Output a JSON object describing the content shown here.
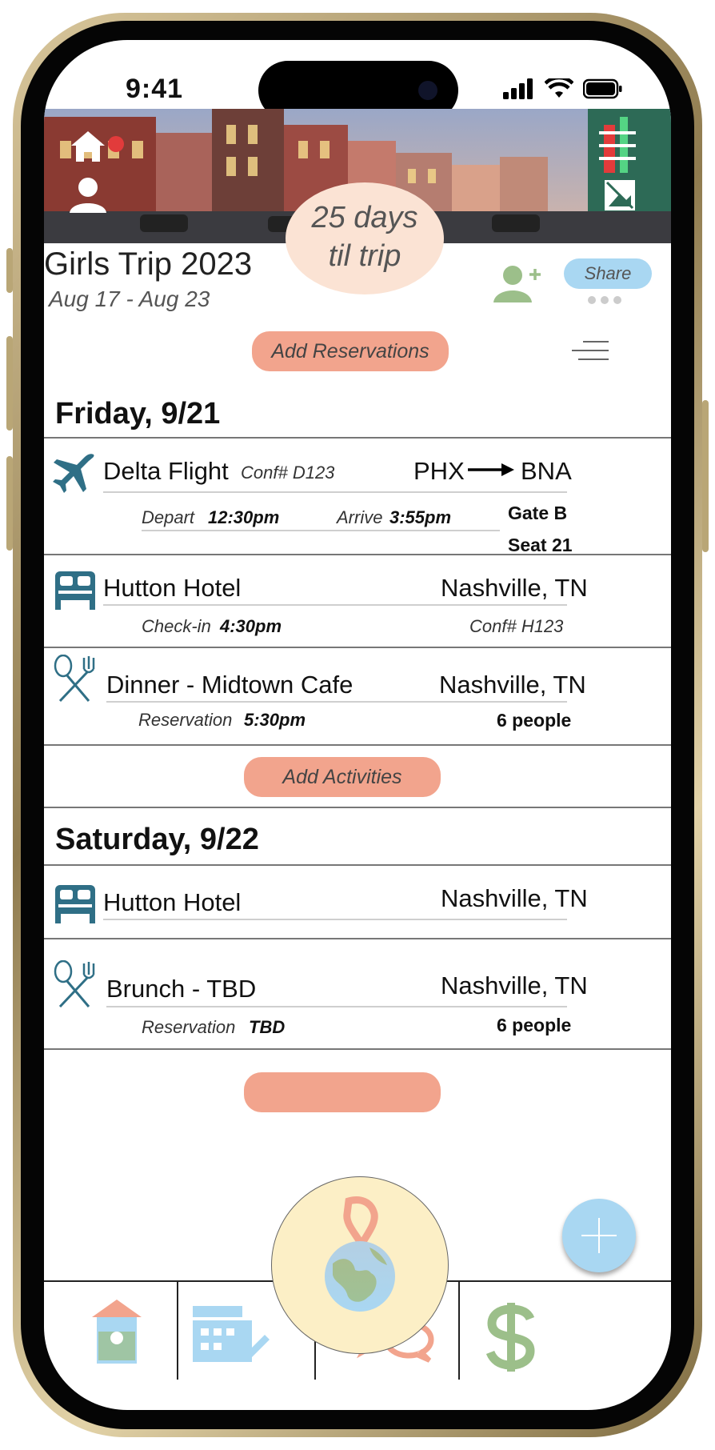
{
  "status_bar": {
    "time": "9:41"
  },
  "trip": {
    "title": "Girls Trip 2023",
    "dates": "Aug 17 - Aug 23",
    "countdown_line1": "25 days",
    "countdown_line2": "til trip",
    "share_label": "Share"
  },
  "actions": {
    "add_reservations": "Add Reservations",
    "add_activities": "Add Activities"
  },
  "days": [
    {
      "heading": "Friday, 9/21",
      "flight": {
        "name": "Delta Flight",
        "conf": "Conf# D123",
        "from": "PHX",
        "to": "BNA",
        "depart_label": "Depart",
        "depart_time": "12:30pm",
        "arrive_label": "Arrive",
        "arrive_time": "3:55pm",
        "gate": "Gate B",
        "seat": "Seat 21"
      },
      "hotel": {
        "name": "Hutton Hotel",
        "location": "Nashville, TN",
        "checkin_label": "Check-in",
        "checkin_time": "4:30pm",
        "conf": "Conf# H123"
      },
      "dinner": {
        "name": "Dinner - Midtown Cafe",
        "location": "Nashville, TN",
        "res_label": "Reservation",
        "res_time": "5:30pm",
        "party": "6 people"
      }
    },
    {
      "heading": "Saturday, 9/22",
      "hotel": {
        "name": "Hutton Hotel",
        "location": "Nashville, TN"
      },
      "brunch": {
        "name": "Brunch - TBD",
        "location": "Nashville, TN",
        "res_label": "Reservation",
        "res_time": "TBD",
        "party": "6 people"
      }
    }
  ],
  "colors": {
    "accent_salmon": "#f2a48d",
    "accent_blue": "#a9d7f2",
    "accent_green": "#9cbf8a",
    "icon_teal": "#2f6f86",
    "countdown_bg": "#fbe3d4"
  },
  "icons": [
    "home-icon",
    "user-icon",
    "menu-icon",
    "image-icon",
    "add-person-icon",
    "filter-icon",
    "plane-icon",
    "bed-icon",
    "utensils-icon",
    "plus-icon",
    "itinerary-icon",
    "calendar-edit-icon",
    "chat-icon",
    "dollar-icon",
    "globe-pin-icon"
  ]
}
